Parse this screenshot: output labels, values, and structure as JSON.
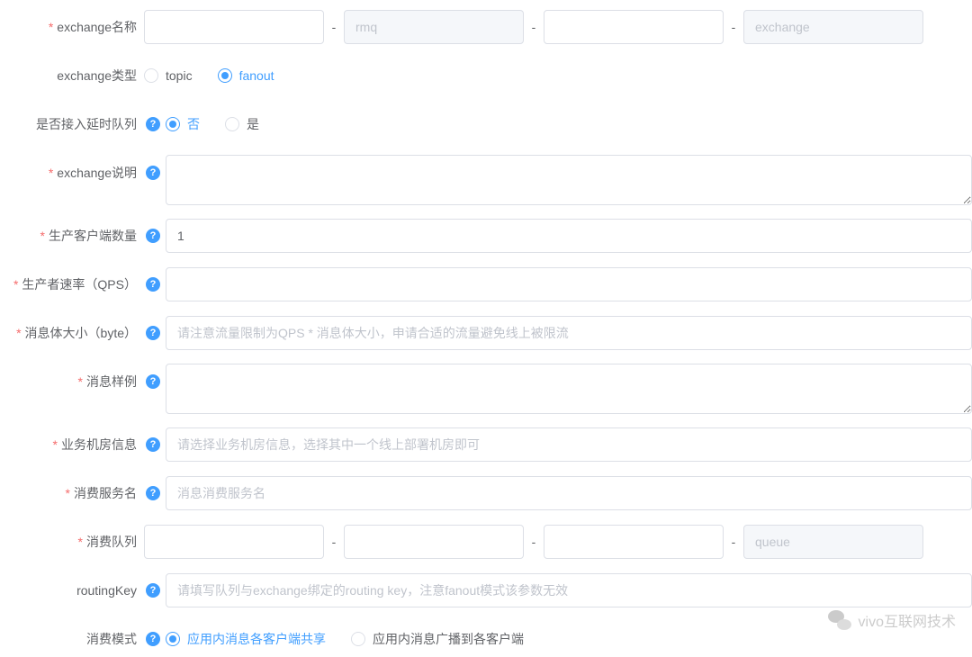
{
  "form": {
    "exchange_name": {
      "label": "exchange名称",
      "seg1": "",
      "seg2_placeholder": "rmq",
      "seg3": "",
      "seg4_placeholder": "exchange"
    },
    "exchange_type": {
      "label": "exchange类型",
      "options": [
        "topic",
        "fanout"
      ],
      "selected": "fanout"
    },
    "delay_queue": {
      "label": "是否接入延时队列",
      "options": [
        "否",
        "是"
      ],
      "selected": "否"
    },
    "exchange_desc": {
      "label": "exchange说明",
      "value": ""
    },
    "producer_clients": {
      "label": "生产客户端数量",
      "value": "1"
    },
    "producer_qps": {
      "label": "生产者速率（QPS）",
      "value": ""
    },
    "message_size": {
      "label": "消息体大小（byte）",
      "placeholder": "请注意流量限制为QPS * 消息体大小，申请合适的流量避免线上被限流"
    },
    "message_sample": {
      "label": "消息样例",
      "value": ""
    },
    "biz_dc": {
      "label": "业务机房信息",
      "placeholder": "请选择业务机房信息，选择其中一个线上部署机房即可"
    },
    "consumer_service": {
      "label": "消费服务名",
      "placeholder": "消息消费服务名"
    },
    "consumer_queue": {
      "label": "消费队列",
      "seg1": "",
      "seg2": "",
      "seg3": "",
      "seg4_placeholder": "queue"
    },
    "routing_key": {
      "label": "routingKey",
      "placeholder": "请填写队列与exchange绑定的routing key，注意fanout模式该参数无效"
    },
    "consume_mode": {
      "label": "消费模式",
      "options": [
        "应用内消息各客户端共享",
        "应用内消息广播到各客户端"
      ],
      "selected": "应用内消息各客户端共享"
    }
  },
  "watermark": "vivo互联网技术"
}
